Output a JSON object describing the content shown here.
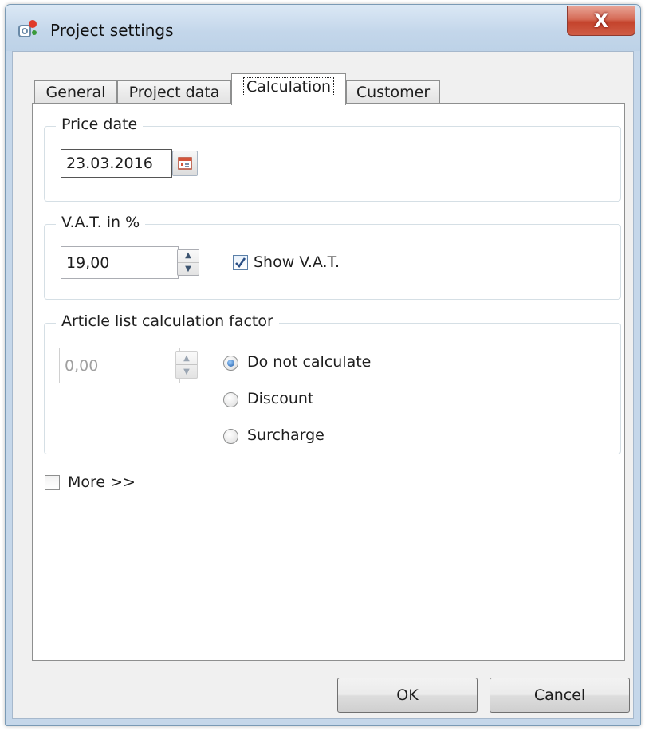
{
  "window": {
    "title": "Project settings",
    "close_glyph": "X",
    "app_icon": "project-settings-app-icon"
  },
  "tabs": [
    {
      "label": "General",
      "active": false
    },
    {
      "label": "Project data",
      "active": false
    },
    {
      "label": "Calculation",
      "active": true
    },
    {
      "label": "Customer",
      "active": false
    }
  ],
  "price_date": {
    "title": "Price date",
    "value": "23.03.2016",
    "calendar_icon": "calendar-icon"
  },
  "vat": {
    "title": "V.A.T. in %",
    "value": "19,00",
    "show_vat_label": "Show V.A.T.",
    "show_vat_checked": true
  },
  "article_factor": {
    "title": "Article list calculation factor",
    "value": "0,00",
    "options": [
      {
        "label": "Do not calculate",
        "selected": true
      },
      {
        "label": "Discount",
        "selected": false
      },
      {
        "label": "Surcharge",
        "selected": false
      }
    ]
  },
  "more": {
    "label": "More >>",
    "checked": false
  },
  "buttons": {
    "ok": "OK",
    "cancel": "Cancel"
  },
  "colors": {
    "frame": "#c5d7ea",
    "close_button": "#c4432c",
    "radio_dot": "#1f5aa6",
    "check_mark": "#2a4f86"
  }
}
